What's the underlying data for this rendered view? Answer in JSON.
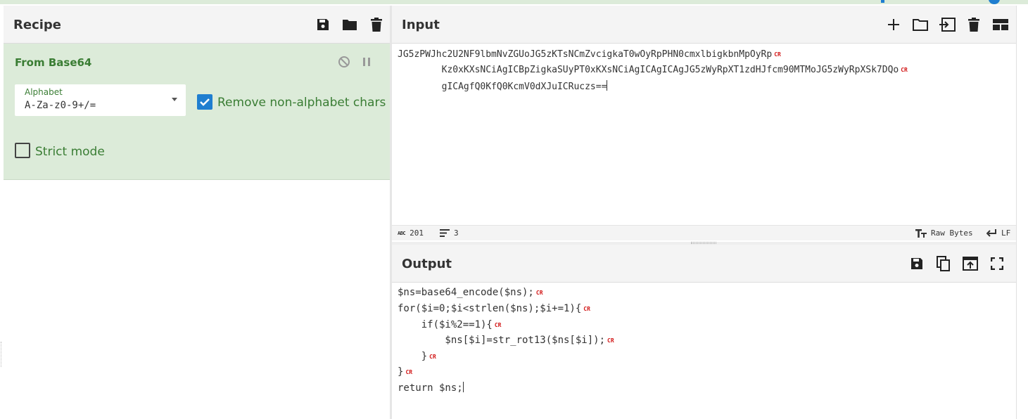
{
  "recipe": {
    "title": "Recipe",
    "icons": [
      "save-icon",
      "folder-icon",
      "trash-icon"
    ],
    "operation": {
      "name": "From Base64",
      "alphabet_label": "Alphabet",
      "alphabet_value": "A-Za-z0-9+/=",
      "remove_non_alphabet_label": "Remove non-alphabet chars",
      "remove_non_alphabet_checked": true,
      "strict_mode_label": "Strict mode",
      "strict_mode_checked": false
    }
  },
  "input": {
    "title": "Input",
    "lines": [
      "JG5zPWJhc2U2NF9lbmNvZGUoJG5zKTsNCmZvcigkaT0wOyRpPHN0cmxlbigkbnMpOyRp",
      "        Kz0xKXsNCiAgICBpZigkaSUyPT0xKXsNCiAgICAgICAgJG5zWyRpXT1zdHJfcm90MTMoJG5zWyRpXSk7DQo",
      "        gICAgfQ0KfQ0KcmV0dXJuICRuczs=="
    ],
    "line_end_marker": "CR",
    "char_count": "201",
    "line_count": "3",
    "encoding": "Raw Bytes",
    "eol": "LF"
  },
  "output": {
    "title": "Output",
    "lines": [
      "$ns=base64_encode($ns);",
      "for($i=0;$i<strlen($ns);$i+=1){",
      "    if($i%2==1){",
      "        $ns[$i]=str_rot13($ns[$i]);",
      "    }",
      "}",
      "return $ns;"
    ],
    "line_end_marker": "CR"
  },
  "colors": {
    "accent_green": "#3a7d34",
    "op_background": "#dcebd9",
    "checkbox_blue": "#1f7ed0",
    "cr_red": "#d21515"
  }
}
